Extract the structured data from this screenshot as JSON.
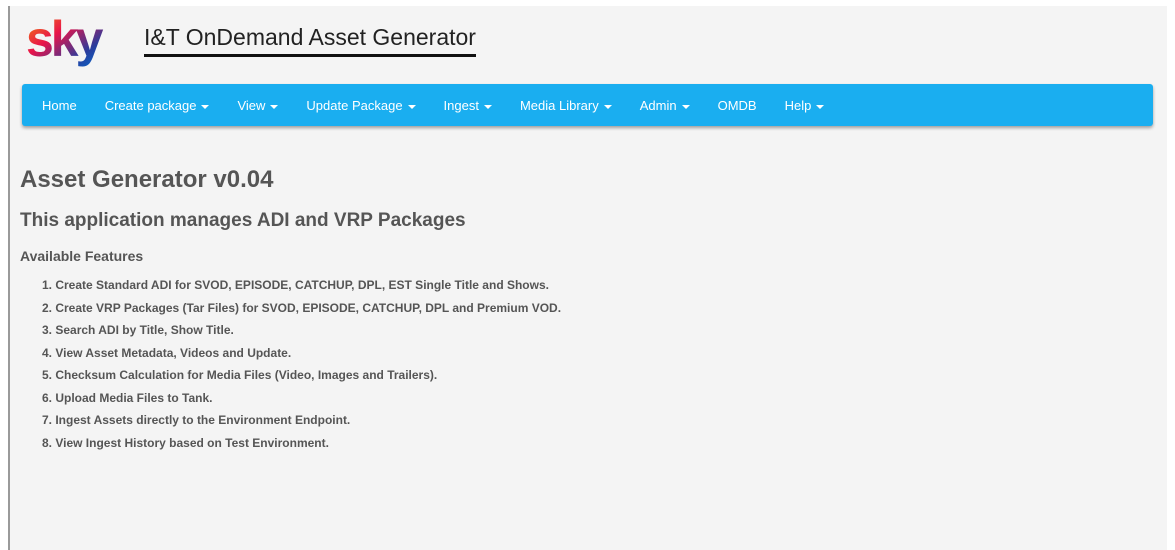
{
  "header": {
    "logo_text": "sky",
    "title": "I&T OnDemand Asset Generator"
  },
  "colors": {
    "nav_background": "#1aaef0",
    "logo_gradient": [
      "#f59c00",
      "#e8134a",
      "#2a3c9c",
      "#0070d2"
    ],
    "text": "#555555"
  },
  "nav": {
    "items": [
      {
        "label": "Home",
        "dropdown": false
      },
      {
        "label": "Create package",
        "dropdown": true
      },
      {
        "label": "View",
        "dropdown": true
      },
      {
        "label": "Update Package",
        "dropdown": true
      },
      {
        "label": "Ingest",
        "dropdown": true
      },
      {
        "label": "Media Library",
        "dropdown": true
      },
      {
        "label": "Admin",
        "dropdown": true
      },
      {
        "label": "OMDB",
        "dropdown": false
      },
      {
        "label": "Help",
        "dropdown": true
      }
    ]
  },
  "main": {
    "title": "Asset Generator v0.04",
    "subtitle": "This application manages ADI and VRP Packages",
    "features_heading": "Available Features",
    "features": [
      "1. Create Standard ADI for SVOD, EPISODE, CATCHUP, DPL, EST Single Title and Shows.",
      "2. Create VRP Packages (Tar Files) for SVOD, EPISODE, CATCHUP, DPL and Premium VOD.",
      "3. Search ADI by Title, Show Title.",
      "4. View Asset Metadata, Videos and Update.",
      "5. Checksum Calculation for Media Files (Video, Images and Trailers).",
      "6. Upload Media Files to Tank.",
      "7. Ingest Assets directly to the Environment Endpoint.",
      "8. View Ingest History based on Test Environment."
    ]
  }
}
